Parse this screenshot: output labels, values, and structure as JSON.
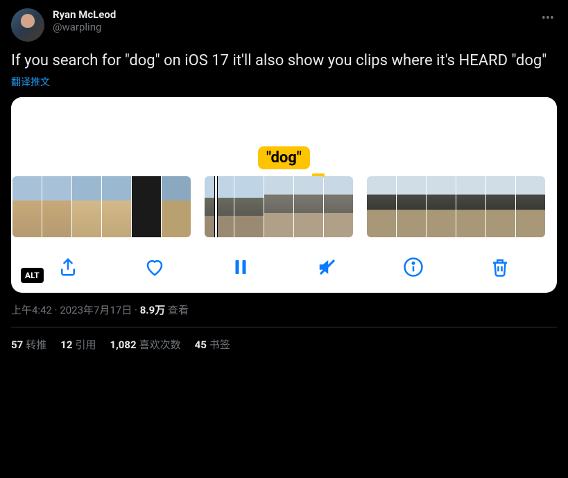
{
  "author": {
    "display_name": "Ryan McLeod",
    "handle": "@warpling"
  },
  "tweet_text": "If you search for \"dog\" on iOS 17 it'll also show you clips where it's HEARD \"dog\"",
  "translate_label": "翻译推文",
  "media": {
    "search_tag": "\"dog\"",
    "alt_badge": "ALT",
    "toolbar_icons": {
      "share": "share-icon",
      "like": "heart-icon",
      "pause": "pause-icon",
      "mute": "mute-icon",
      "info": "info-icon",
      "delete": "trash-icon"
    }
  },
  "meta": {
    "time": "上午4:42",
    "separator": " · ",
    "date": "2023年7月17日",
    "views_count": "8.9万",
    "views_label": " 查看"
  },
  "stats": {
    "retweets_count": "57",
    "retweets_label": "转推",
    "quotes_count": "12",
    "quotes_label": "引用",
    "likes_count": "1,082",
    "likes_label": "喜欢次数",
    "bookmarks_count": "45",
    "bookmarks_label": "书签"
  }
}
